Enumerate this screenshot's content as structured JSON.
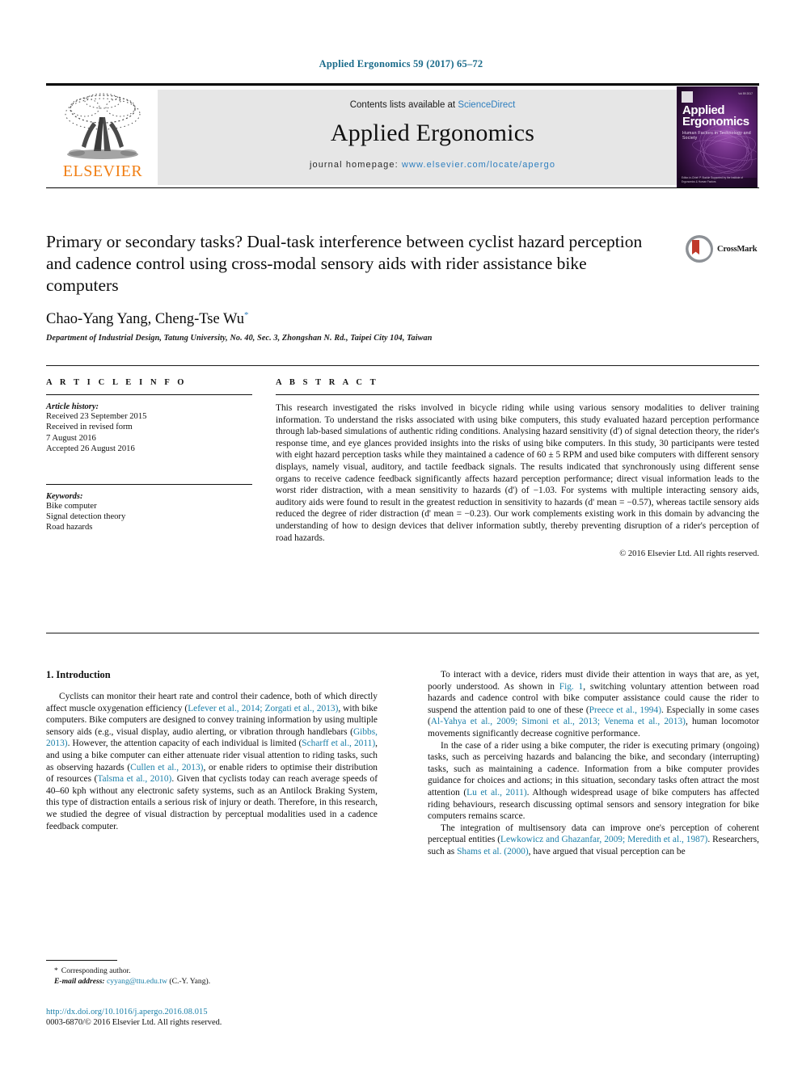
{
  "running_head": "Applied Ergonomics 59 (2017) 65–72",
  "masthead": {
    "contents_prefix": "Contents lists available at ",
    "sciencedirect": "ScienceDirect",
    "journal_title": "Applied Ergonomics",
    "homepage_prefix": "journal homepage: ",
    "homepage_url": "www.elsevier.com/locate/apergo",
    "publisher": "ELSEVIER",
    "logo_icon": "elsevier-tree-icon",
    "cover": {
      "title_line1": "Applied",
      "title_line2": "Ergonomics",
      "subtitle": "Human Factors in Technology and Society",
      "issue_code": "Vol 59 2017",
      "footer": "Editor-in-Chief: P. Buckle\nSupported by the Institute of Ergonomics & Human Factors"
    }
  },
  "article": {
    "title": "Primary or secondary tasks? Dual-task interference between cyclist hazard perception and cadence control using cross-modal sensory aids with rider assistance bike computers",
    "authors": "Chao-Yang Yang, Cheng-Tse Wu",
    "author_marker": "*",
    "affiliation": "Department of Industrial Design, Tatung University, No. 40, Sec. 3, Zhongshan N. Rd., Taipei City 104, Taiwan",
    "crossmark_label": "CrossMark"
  },
  "article_info": {
    "heading": "A R T I C L E   I N F O",
    "history_label": "Article history:",
    "history": [
      "Received 23 September 2015",
      "Received in revised form",
      "7 August 2016",
      "Accepted 26 August 2016"
    ],
    "keywords_label": "Keywords:",
    "keywords": [
      "Bike computer",
      "Signal detection theory",
      "Road hazards"
    ]
  },
  "abstract": {
    "heading": "A B S T R A C T",
    "text": "This research investigated the risks involved in bicycle riding while using various sensory modalities to deliver training information. To understand the risks associated with using bike computers, this study evaluated hazard perception performance through lab-based simulations of authentic riding conditions. Analysing hazard sensitivity (d') of signal detection theory, the rider's response time, and eye glances provided insights into the risks of using bike computers. In this study, 30 participants were tested with eight hazard perception tasks while they maintained a cadence of 60 ± 5 RPM and used bike computers with different sensory displays, namely visual, auditory, and tactile feedback signals. The results indicated that synchronously using different sense organs to receive cadence feedback significantly affects hazard perception performance; direct visual information leads to the worst rider distraction, with a mean sensitivity to hazards (d') of −1.03. For systems with multiple interacting sensory aids, auditory aids were found to result in the greatest reduction in sensitivity to hazards (d' mean = −0.57), whereas tactile sensory aids reduced the degree of rider distraction (d' mean = −0.23). Our work complements existing work in this domain by advancing the understanding of how to design devices that deliver information subtly, thereby preventing disruption of a rider's perception of road hazards.",
    "copyright": "© 2016 Elsevier Ltd. All rights reserved."
  },
  "body": {
    "section_title": "1. Introduction",
    "left_paragraphs": [
      "Cyclists can monitor their heart rate and control their cadence, both of which directly affect muscle oxygenation efficiency (Lefever et al., 2014; Zorgati et al., 2013), with bike computers. Bike computers are designed to convey training information by using multiple sensory aids (e.g., visual display, audio alerting, or vibration through handlebars (Gibbs, 2013). However, the attention capacity of each individual is limited (Scharff et al., 2011), and using a bike computer can either attenuate rider visual attention to riding tasks, such as observing hazards (Cullen et al., 2013), or enable riders to optimise their distribution of resources (Talsma et al., 2010). Given that cyclists today can reach average speeds of 40–60 kph without any electronic safety systems, such as an Antilock Braking System, this type of distraction entails a serious risk of injury or death. Therefore, in this research, we studied the degree of visual distraction by perceptual modalities used in a cadence feedback computer."
    ],
    "right_paragraphs": [
      "To interact with a device, riders must divide their attention in ways that are, as yet, poorly understood. As shown in Fig. 1, switching voluntary attention between road hazards and cadence control with bike computer assistance could cause the rider to suspend the attention paid to one of these (Preece et al., 1994). Especially in some cases (Al-Yahya et al., 2009; Simoni et al., 2013; Venema et al., 2013), human locomotor movements significantly decrease cognitive performance.",
      "In the case of a rider using a bike computer, the rider is executing primary (ongoing) tasks, such as perceiving hazards and balancing the bike, and secondary (interrupting) tasks, such as maintaining a cadence. Information from a bike computer provides guidance for choices and actions; in this situation, secondary tasks often attract the most attention (Lu et al., 2011). Although widespread usage of bike computers has affected riding behaviours, research discussing optimal sensors and sensory integration for bike computers remains scarce.",
      "The integration of multisensory data can improve one's perception of coherent perceptual entities (Lewkowicz and Ghazanfar, 2009; Meredith et al., 1987). Researchers, such as Shams et al. (2000), have argued that visual perception can be"
    ]
  },
  "footnote": {
    "corresponding_marker": "*",
    "corresponding_label": "Corresponding author.",
    "email_label": "E-mail address:",
    "email": "cyyang@ttu.edu.tw",
    "email_owner": "(C.-Y. Yang)."
  },
  "footer": {
    "doi": "http://dx.doi.org/10.1016/j.apergo.2016.08.015",
    "issn": "0003-6870/© 2016 Elsevier Ltd. All rights reserved."
  },
  "colors": {
    "link": "#1a7fa8",
    "running_head": "#1a6b8a",
    "elsevier_orange": "#f07e13",
    "sciencedirect_blue": "#2f7fbf",
    "cover_purple": "#2a0b34"
  }
}
